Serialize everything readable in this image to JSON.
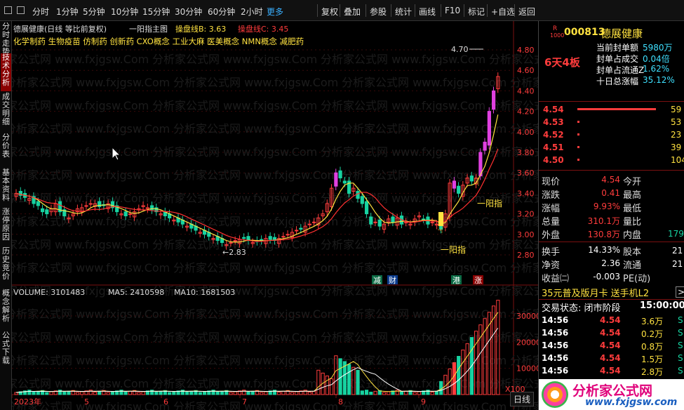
{
  "toolbar": {
    "periods": [
      "分时",
      "1分钟",
      "5分钟",
      "10分钟",
      "15分钟",
      "30分钟",
      "60分钟",
      "2小时"
    ],
    "more": "更多",
    "actions": [
      "复权",
      "叠加",
      "参股",
      "统计",
      "画线",
      "F10",
      "标记",
      "+自选",
      "返回"
    ]
  },
  "left_tabs": [
    "分时走势",
    "技术分析",
    "成交明细",
    "分价表",
    "基本资料",
    "涨停原因",
    "历史竞价",
    "概念解析",
    "公式下载"
  ],
  "chart_header": {
    "stock_line": "德展健康(日线 等比前复权)",
    "indicator_name": "一阳指主图",
    "line_b_label": "操盘线B: 3.63",
    "line_c_label": "操盘线C: 3.45",
    "concepts": "化学制药  生物疫苗  仿制药  创新药  CXO概念  工业大麻  医美概念  NMN概念  减肥药"
  },
  "price_axis": [
    "4.80",
    "4.60",
    "4.40",
    "4.20",
    "4.00",
    "3.80",
    "3.60",
    "3.40",
    "3.20",
    "3.00",
    "2.80"
  ],
  "volume_axis": [
    "30000",
    "20000",
    "10000"
  ],
  "volume_unit": "X100",
  "volume_header": {
    "volume": "VOLUME: 3101483",
    "ma5": "MA5: 2410598",
    "ma10": "MA10: 1681503"
  },
  "date_axis": [
    "2023年",
    "5",
    "6",
    "7",
    "8",
    "9"
  ],
  "annotations": {
    "high_label": "4.70",
    "low_label": "2.83",
    "signal_1": "一阳指",
    "signal_2": "一阳指",
    "tag_jian": "减",
    "tag_cai": "财",
    "tag_gang": "港",
    "tag_zhang": "涨"
  },
  "watermark": "分析家公式网 www.fxjgsw.Com",
  "period_button": "日线",
  "stock": {
    "market_badge": "R",
    "market_num": "1000",
    "code": "000813",
    "name": "德展健康",
    "limit_board": "6天4板",
    "seal_stats": [
      {
        "label": "当前封单额",
        "value": "5980万"
      },
      {
        "label": "封单占成交",
        "value": "0.04倍"
      },
      {
        "label": "封单占流通Z",
        "value": "1.62%"
      },
      {
        "label": "十日总涨幅",
        "value": "35.12%"
      }
    ],
    "bids": [
      {
        "price": "4.54",
        "qty": "59"
      },
      {
        "price": "4.53",
        "qty": "53"
      },
      {
        "price": "4.52",
        "qty": "23"
      },
      {
        "price": "4.51",
        "qty": "39"
      },
      {
        "price": "4.50",
        "qty": "104"
      }
    ],
    "quote": [
      {
        "l": "现价",
        "v": "4.54",
        "r": "今开"
      },
      {
        "l": "涨跌",
        "v": "0.41",
        "r": "最高"
      },
      {
        "l": "涨幅",
        "v": "9.93%",
        "r": "最低"
      },
      {
        "l": "总量",
        "v": "310.1万",
        "r": "量比"
      },
      {
        "l": "外盘",
        "v": "130.8万",
        "r": "内盘",
        "rv": "179"
      }
    ],
    "fundamentals": [
      {
        "l": "换手",
        "v": "14.33%",
        "r": "股本",
        "rv": "21"
      },
      {
        "l": "净资",
        "v": "2.36",
        "r": "流通",
        "rv": "21"
      },
      {
        "l": "收益㈡",
        "v": "-0.003",
        "r": "PE(动)",
        "rv": ""
      }
    ],
    "promo": "35元普及版月卡 送手机L2",
    "promo_arrow": ">",
    "trade_status_label": "交易状态: 闭市阶段",
    "trade_status_time": "15:00:00",
    "ticks": [
      {
        "t": "14:56",
        "p": "4.54",
        "v": "3.6万",
        "s": "S"
      },
      {
        "t": "14:56",
        "p": "4.54",
        "v": "0.2万",
        "s": "S"
      },
      {
        "t": "14:56",
        "p": "4.54",
        "v": "0.8万",
        "s": "S"
      },
      {
        "t": "14:56",
        "p": "4.54",
        "v": "1.5万",
        "s": "S"
      },
      {
        "t": "14:56",
        "p": "4.54",
        "v": "2.8万",
        "s": "S"
      }
    ]
  },
  "logo": {
    "name": "分析家公式网",
    "url": "www.fxjgsw.com"
  },
  "colors": {
    "up": "#ff3c3c",
    "down": "#17d3a1",
    "limit": "#e040e0",
    "ma_yellow": "#ffe240",
    "ma_red": "#ff3030",
    "bg": "#000000"
  }
}
